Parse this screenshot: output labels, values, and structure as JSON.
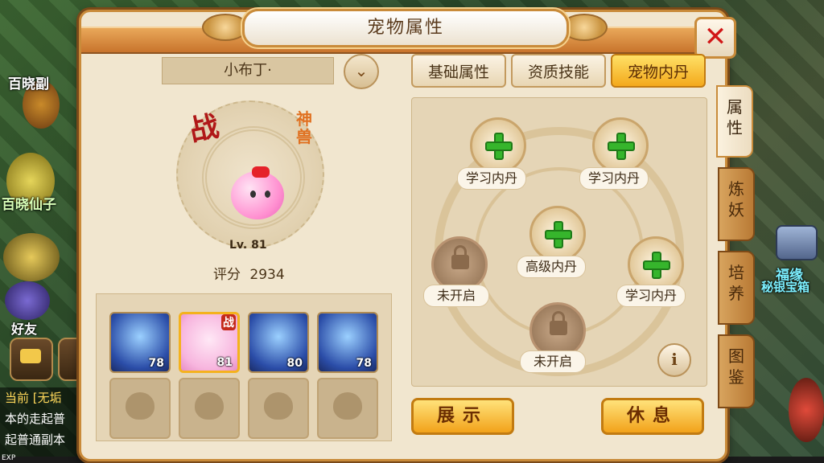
{
  "window": {
    "title": "宠物属性"
  },
  "world": {
    "labels": [
      "百晓副",
      "百晓仙子",
      "福缘",
      "秘银宝箱"
    ],
    "friends_label": "好友"
  },
  "chat": {
    "lines": [
      "当前 [无垢",
      "本的走起普",
      "起普通副本"
    ]
  },
  "exp_label": "EXP",
  "pet": {
    "name": "小布丁·",
    "battle_mark": "战",
    "rarity_mark": "神兽",
    "level_text": "Lv. 81",
    "score_label": "评分",
    "score_value": "2934"
  },
  "pet_slots": [
    {
      "type": "filled",
      "level": "78",
      "badge": ""
    },
    {
      "type": "selected",
      "level": "81",
      "badge": "战"
    },
    {
      "type": "filled",
      "level": "80",
      "badge": ""
    },
    {
      "type": "filled",
      "level": "78",
      "badge": ""
    },
    {
      "type": "empty",
      "level": "",
      "badge": ""
    },
    {
      "type": "empty",
      "level": "",
      "badge": ""
    },
    {
      "type": "empty",
      "level": "",
      "badge": ""
    },
    {
      "type": "empty",
      "level": "",
      "badge": ""
    }
  ],
  "tabs": [
    "基础属性",
    "资质技能",
    "宠物内丹"
  ],
  "active_tab": "宠物内丹",
  "dan_nodes": [
    {
      "id": "top-left",
      "state": "open",
      "label": "学习内丹"
    },
    {
      "id": "top-right",
      "state": "open",
      "label": "学习内丹"
    },
    {
      "id": "center",
      "state": "open",
      "label": "高级内丹"
    },
    {
      "id": "mid-left",
      "state": "locked",
      "label": "未开启"
    },
    {
      "id": "mid-right",
      "state": "open",
      "label": "学习内丹"
    },
    {
      "id": "bottom",
      "state": "locked",
      "label": "未开启"
    }
  ],
  "info_icon": "i",
  "buttons": {
    "show": "展示",
    "rest": "休息"
  },
  "side_tabs": [
    "属性",
    "炼妖",
    "培养",
    "图鉴"
  ],
  "colors": {
    "accent": "#f3a91c",
    "plus": "#36b52c",
    "close": "#d11616",
    "panel": "#f1e6cf"
  }
}
